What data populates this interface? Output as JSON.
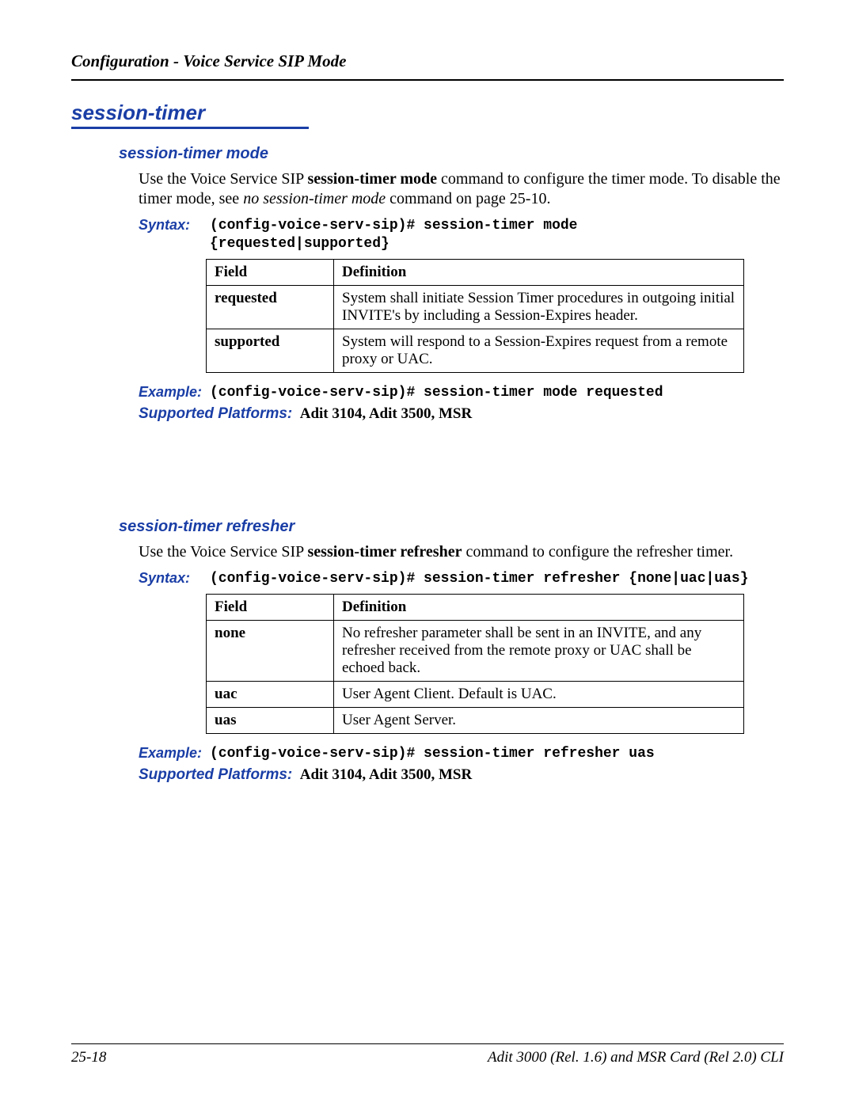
{
  "header": {
    "title": "Configuration - Voice Service SIP Mode"
  },
  "main_heading": "session-timer",
  "sections": [
    {
      "heading": "session-timer mode",
      "intro_pre": "Use the Voice Service SIP ",
      "intro_bold": "session-timer mode",
      "intro_mid": " command to configure the timer mode. To disable the timer mode, see ",
      "intro_italic": "no session-timer mode",
      "intro_post": " command on page 25-10.",
      "syntax_label": "Syntax:",
      "syntax": "(config-voice-serv-sip)# session-timer mode\n{requested|supported}",
      "table_headers": {
        "field": "Field",
        "definition": "Definition"
      },
      "rows": [
        {
          "field": "requested",
          "definition": "System shall initiate Session Timer procedures in outgoing initial INVITE's by including a Session-Expires header."
        },
        {
          "field": "supported",
          "definition": "System will respond to a Session-Expires request from a remote proxy or UAC."
        }
      ],
      "example_label": "Example:",
      "example": "(config-voice-serv-sip)# session-timer mode requested",
      "platforms_label": "Supported Platforms:",
      "platforms": "Adit 3104, Adit 3500, MSR"
    },
    {
      "heading": "session-timer refresher",
      "intro_pre": "Use the Voice Service SIP ",
      "intro_bold": "session-timer refresher",
      "intro_mid": " command to configure the refresher timer.",
      "intro_italic": "",
      "intro_post": "",
      "syntax_label": "Syntax:",
      "syntax": "(config-voice-serv-sip)# session-timer refresher {none|uac|uas}",
      "table_headers": {
        "field": "Field",
        "definition": "Definition"
      },
      "rows": [
        {
          "field": "none",
          "definition": "No refresher parameter shall be sent in an INVITE, and any refresher received from the remote proxy or UAC shall be echoed back."
        },
        {
          "field": "uac",
          "definition": "User Agent Client. Default is UAC."
        },
        {
          "field": "uas",
          "definition": "User Agent Server."
        }
      ],
      "example_label": "Example:",
      "example": "(config-voice-serv-sip)# session-timer refresher uas",
      "platforms_label": "Supported Platforms:",
      "platforms": "Adit 3104, Adit 3500, MSR"
    }
  ],
  "footer": {
    "page_number": "25-18",
    "book": "Adit 3000 (Rel. 1.6) and MSR Card (Rel 2.0) CLI"
  }
}
